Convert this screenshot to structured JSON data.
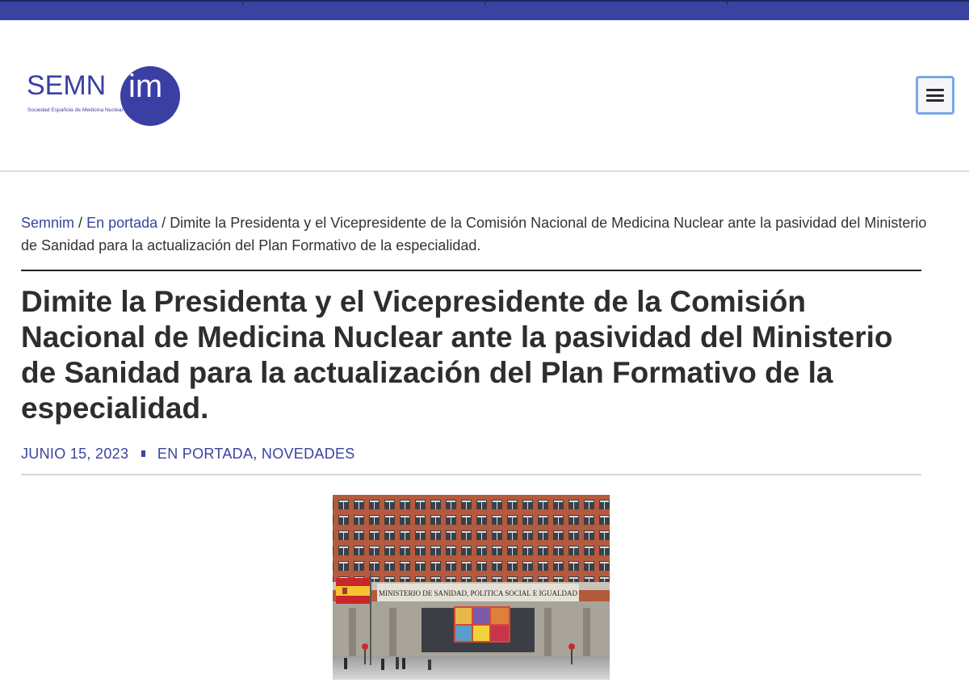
{
  "header": {
    "logo": {
      "brand_prefix": "SEMN",
      "brand_suffix": "im",
      "tagline": "Sociedad Española de Medicina Nuclear e Imagen Molecular"
    },
    "menu_icon": "hamburger-menu-icon"
  },
  "breadcrumb": {
    "items": [
      "Semnim",
      "En portada"
    ],
    "separator": "/",
    "current": "Dimite la Presidenta y el Vicepresidente de la Comisión Nacional de Medicina Nuclear ante la pasividad del Ministerio de Sanidad para la actualización del Plan Formativo de la especialidad."
  },
  "article": {
    "title": "Dimite la Presidenta y el Vicepresidente de la Comisión Nacional de Medicina Nuclear ante la pasividad del Ministerio de Sanidad para la actualización del Plan Formativo de la especialidad.",
    "date": "JUNIO 15, 2023",
    "categories": [
      "EN PORTADA",
      "NOVEDADES"
    ],
    "image": {
      "building_sign": "MINISTERIO DE SANIDAD, POLITICA SOCIAL E IGUALDAD"
    }
  },
  "colors": {
    "accent": "#3a43a0",
    "text": "#333333",
    "menu_focus": "#7aa8e6"
  }
}
